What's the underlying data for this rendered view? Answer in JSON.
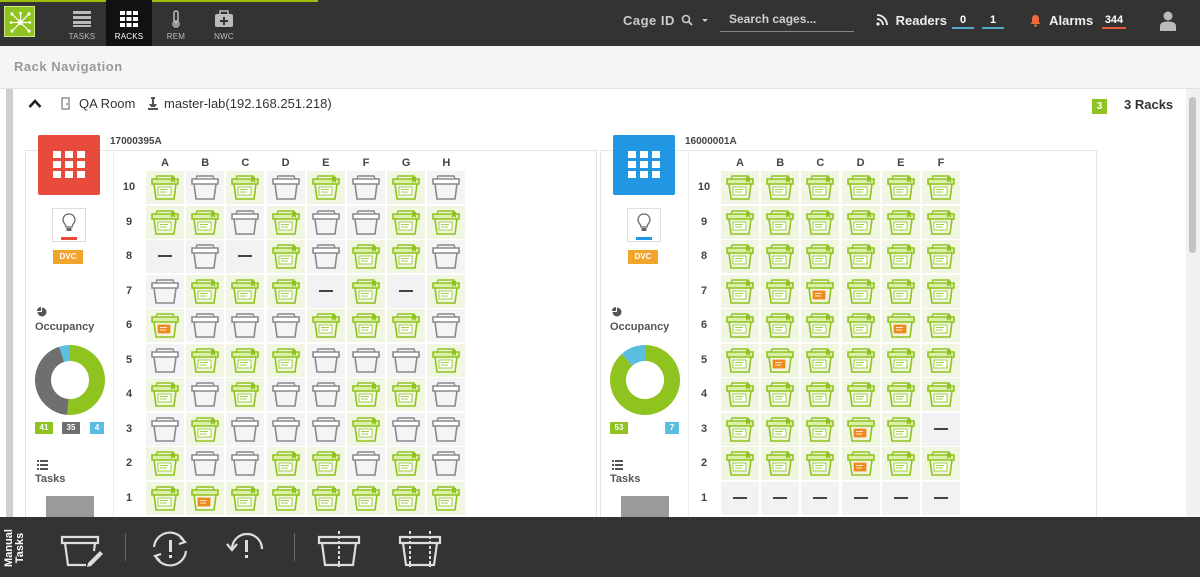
{
  "header": {
    "nav": [
      {
        "label": "TASKS",
        "icon": "tasks-icon"
      },
      {
        "label": "RACKS",
        "icon": "racks-icon",
        "active": true
      },
      {
        "label": "REM",
        "icon": "thermometer-icon"
      },
      {
        "label": "NWC",
        "icon": "medkit-icon"
      }
    ],
    "search_mode": "Cage ID",
    "search_placeholder": "Search cages...",
    "readers_label": "Readers",
    "readers_counts": [
      "0",
      "1"
    ],
    "alarms_label": "Alarms",
    "alarms_count": "344"
  },
  "page": {
    "title": "Rack Navigation",
    "room": "QA Room",
    "host": "master-lab(192.168.251.218)",
    "rack_count_badge": "3",
    "rack_count_label": "3 Racks"
  },
  "colors": {
    "accent_green": "#8fc31f",
    "rack1_color": "#e84b3c",
    "rack2_color": "#2196e3",
    "dvc_orange": "#f2a52c",
    "occupied_gray": "#6f6f6f",
    "unused_blue": "#5bbde0"
  },
  "racks": [
    {
      "id": "17000395A",
      "color": "red",
      "dvc_label": "DVC",
      "occupancy_label": "Occupancy",
      "occupancy": {
        "green": 41,
        "gray": 35,
        "blue": 4
      },
      "tasks_label": "Tasks",
      "columns": [
        "A",
        "B",
        "C",
        "D",
        "E",
        "F",
        "G",
        "H"
      ],
      "rows": [
        "10",
        "9",
        "8",
        "7",
        "6",
        "5",
        "4",
        "3",
        "2",
        "1"
      ],
      "grid": [
        [
          "g",
          "w",
          "g",
          "w",
          "g",
          "w",
          "g",
          "w"
        ],
        [
          "g",
          "g",
          "w",
          "g",
          "w",
          "w",
          "g",
          "g"
        ],
        [
          "x",
          "w",
          "x",
          "g",
          "w",
          "g",
          "g",
          "w"
        ],
        [
          "w",
          "g",
          "g",
          "g",
          "x",
          "g",
          "x",
          "g"
        ],
        [
          "o",
          "w",
          "w",
          "w",
          "g",
          "g",
          "g",
          "w"
        ],
        [
          "w",
          "g",
          "g",
          "g",
          "w",
          "w",
          "w",
          "g"
        ],
        [
          "g",
          "w",
          "g",
          "w",
          "w",
          "g",
          "g",
          "w"
        ],
        [
          "w",
          "g",
          "w",
          "w",
          "w",
          "g",
          "w",
          "w"
        ],
        [
          "g",
          "w",
          "w",
          "g",
          "g",
          "w",
          "g",
          "w"
        ],
        [
          "g",
          "o",
          "g",
          "g",
          "g",
          "g",
          "g",
          "g"
        ]
      ]
    },
    {
      "id": "16000001A",
      "color": "blue",
      "dvc_label": "DVC",
      "occupancy_label": "Occupancy",
      "occupancy": {
        "green": 53,
        "blue": 7
      },
      "tasks_label": "Tasks",
      "columns": [
        "A",
        "B",
        "C",
        "D",
        "E",
        "F"
      ],
      "rows": [
        "10",
        "9",
        "8",
        "7",
        "6",
        "5",
        "4",
        "3",
        "2",
        "1"
      ],
      "grid": [
        [
          "g",
          "g",
          "g",
          "g",
          "g",
          "g"
        ],
        [
          "g",
          "g",
          "g",
          "g",
          "g",
          "g"
        ],
        [
          "g",
          "g",
          "g",
          "g",
          "g",
          "g"
        ],
        [
          "g",
          "g",
          "o",
          "g",
          "g",
          "g"
        ],
        [
          "g",
          "g",
          "g",
          "g",
          "o",
          "g"
        ],
        [
          "g",
          "o",
          "g",
          "g",
          "g",
          "g"
        ],
        [
          "g",
          "g",
          "g",
          "g",
          "g",
          "g"
        ],
        [
          "g",
          "g",
          "g",
          "o",
          "g",
          "x"
        ],
        [
          "g",
          "g",
          "g",
          "o",
          "g",
          "g"
        ],
        [
          "x",
          "x",
          "x",
          "x",
          "x",
          "x"
        ]
      ]
    }
  ],
  "bottom": {
    "label_line1": "Manual",
    "label_line2": "Tasks",
    "tools": [
      "edit-cage-icon",
      "sync-alert-icon",
      "undo-alert-icon",
      "split-cage-icon",
      "merge-cage-icon"
    ]
  }
}
